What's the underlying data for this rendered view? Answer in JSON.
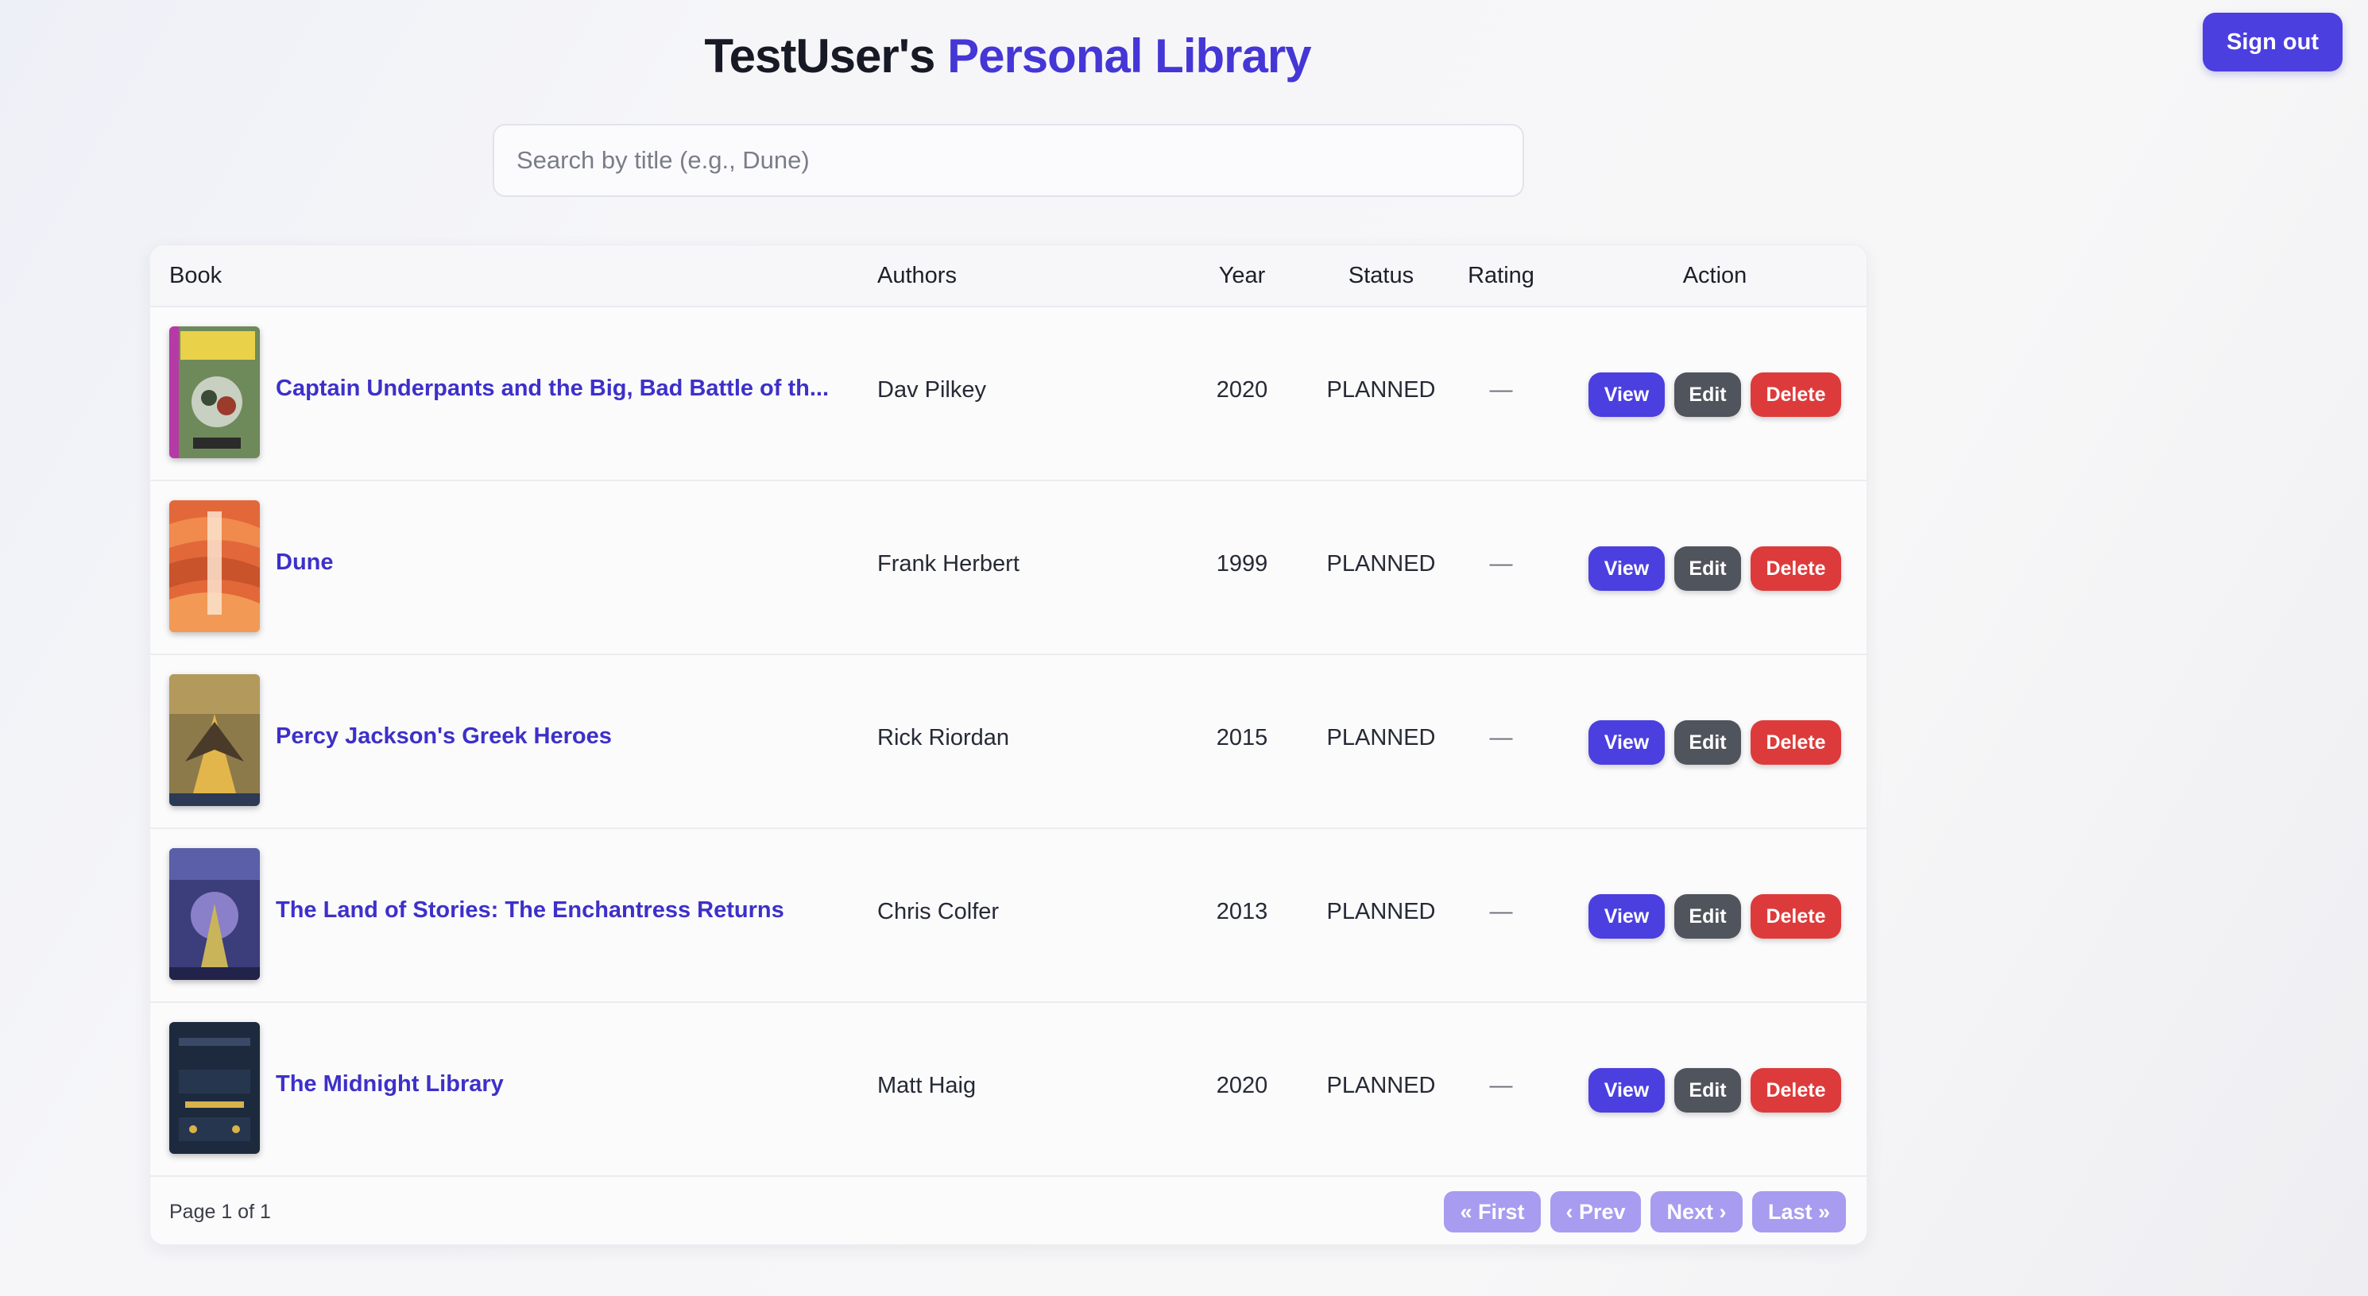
{
  "header": {
    "title_owner": "TestUser's",
    "title_accent": "Personal Library",
    "signout_label": "Sign out"
  },
  "search": {
    "placeholder": "Search by title (e.g., Dune)",
    "value": ""
  },
  "table": {
    "columns": [
      "Book",
      "Authors",
      "Year",
      "Status",
      "Rating",
      "Action"
    ],
    "rows": [
      {
        "title": "Captain Underpants and the Big, Bad Battle of th...",
        "author": "Dav Pilkey",
        "year": "2020",
        "status": "PLANNED",
        "rating": "—",
        "cover_icon": "captain-underpants-cover-icon"
      },
      {
        "title": "Dune",
        "author": "Frank Herbert",
        "year": "1999",
        "status": "PLANNED",
        "rating": "—",
        "cover_icon": "dune-cover-icon"
      },
      {
        "title": "Percy Jackson's Greek Heroes",
        "author": "Rick Riordan",
        "year": "2015",
        "status": "PLANNED",
        "rating": "—",
        "cover_icon": "percy-jackson-cover-icon"
      },
      {
        "title": "The Land of Stories: The Enchantress Returns",
        "author": "Chris Colfer",
        "year": "2013",
        "status": "PLANNED",
        "rating": "—",
        "cover_icon": "land-of-stories-cover-icon"
      },
      {
        "title": "The Midnight Library",
        "author": "Matt Haig",
        "year": "2020",
        "status": "PLANNED",
        "rating": "—",
        "cover_icon": "midnight-library-cover-icon"
      }
    ],
    "actions": {
      "view": "View",
      "edit": "Edit",
      "delete": "Delete"
    }
  },
  "pagination": {
    "page_info": "Page 1 of 1",
    "first": "« First",
    "prev": "‹ Prev",
    "next": "Next ›",
    "last": "Last »"
  },
  "colors": {
    "accent": "#4536d6",
    "view_button": "#4b3fe0",
    "edit_button": "#50545c",
    "delete_button": "#dd3b3b",
    "pagination_button": "#a79cf0"
  }
}
